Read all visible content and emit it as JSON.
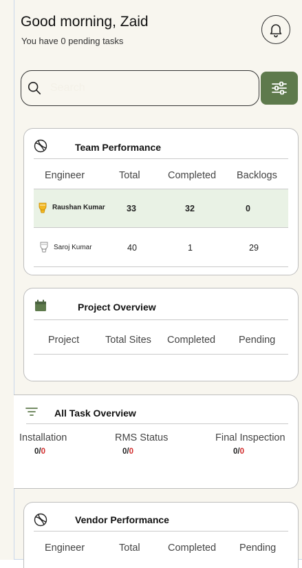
{
  "header": {
    "greeting": "Good morning, Zaid",
    "subtitle": "You have 0 pending tasks"
  },
  "search": {
    "placeholder": "Search"
  },
  "colors": {
    "accent": "#5e7a4c",
    "highlight_row": "#e9f2e5",
    "red": "#d12b2b"
  },
  "team_performance": {
    "title": "Team Performance",
    "icon": "ball-icon",
    "columns": [
      "Engineer",
      "Total",
      "Completed",
      "Backlogs"
    ],
    "rows": [
      {
        "engineer": "Raushan Kumar",
        "total": "33",
        "completed": "32",
        "backlogs": "0",
        "badge": "gold-trophy-icon"
      },
      {
        "engineer": "Saroj Kumar",
        "total": "40",
        "completed": "1",
        "backlogs": "29",
        "badge": "silver-trophy-icon"
      }
    ]
  },
  "project_overview": {
    "title": "Project Overview",
    "icon": "calendar-icon",
    "columns": [
      "Project",
      "Total Sites",
      "Completed",
      "Pending"
    ]
  },
  "all_task_overview": {
    "title": "All Task Overview",
    "icon": "filter-lines-icon",
    "items": [
      {
        "label": "Installation",
        "done": "0",
        "total": "0"
      },
      {
        "label": "RMS Status",
        "done": "0",
        "total": "0"
      },
      {
        "label": "Final Inspection",
        "done": "0",
        "total": "0"
      }
    ]
  },
  "vendor_performance": {
    "title": "Vendor Performance",
    "icon": "ball-icon",
    "columns": [
      "Engineer",
      "Total",
      "Completed",
      "Pending"
    ]
  }
}
